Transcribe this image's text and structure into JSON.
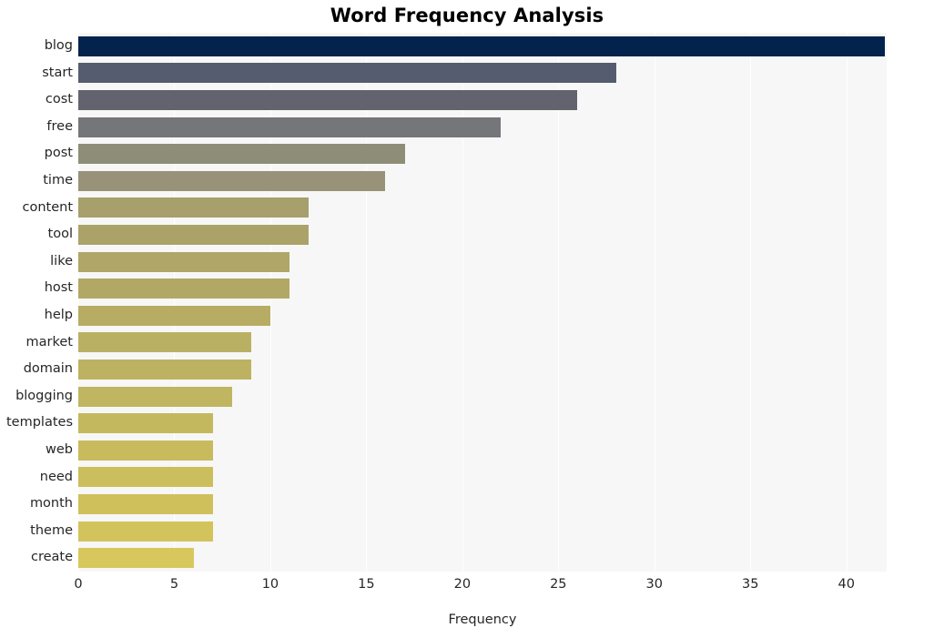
{
  "chart_data": {
    "type": "bar",
    "orientation": "horizontal",
    "title": "Word Frequency Analysis",
    "xlabel": "Frequency",
    "ylabel": "",
    "categories": [
      "blog",
      "start",
      "cost",
      "free",
      "post",
      "time",
      "content",
      "tool",
      "like",
      "host",
      "help",
      "market",
      "domain",
      "blogging",
      "templates",
      "web",
      "need",
      "month",
      "theme",
      "create"
    ],
    "values": [
      42,
      28,
      26,
      22,
      17,
      16,
      12,
      12,
      11,
      11,
      10,
      9,
      9,
      8,
      7,
      7,
      7,
      7,
      7,
      6
    ],
    "xlim": [
      0,
      42.1
    ],
    "xticks": [
      0,
      5,
      10,
      15,
      20,
      25,
      30,
      35,
      40
    ],
    "xtick_labels": [
      "0",
      "5",
      "10",
      "15",
      "20",
      "25",
      "30",
      "35",
      "40"
    ],
    "grid": "vertical-white",
    "legend": "none",
    "bar_colors": [
      "#03224c",
      "#565c6f",
      "#63636f",
      "#75767a",
      "#8e8e78",
      "#989279",
      "#a79f6c",
      "#aaa269",
      "#afa667",
      "#b2a866",
      "#b7ac64",
      "#bab063",
      "#bdb261",
      "#c0b560",
      "#c4b85e",
      "#c8bb5d",
      "#cbbe5c",
      "#cfc05c",
      "#d3c35c",
      "#d8c75c"
    ],
    "plot_background": "#f7f7f7",
    "gridline_color": "#ffffff",
    "text_color": "#262626",
    "figure_background": "#ffffff"
  }
}
